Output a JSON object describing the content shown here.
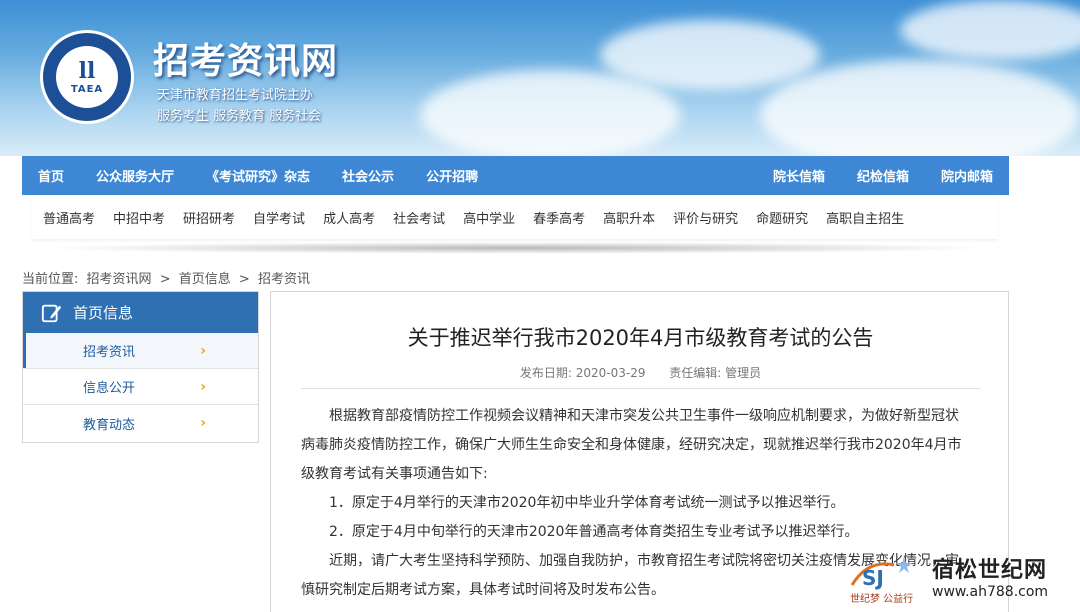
{
  "banner": {
    "logo_mark": "TAEA",
    "site_title": "招考资讯网",
    "subtitle_1": "天津市教育招生考试院主办",
    "subtitle_2": "服务考生 服务教育 服务社会"
  },
  "main_nav": {
    "left": [
      "首页",
      "公众服务大厅",
      "《考试研究》杂志",
      "社会公示",
      "公开招聘"
    ],
    "right": [
      "院长信箱",
      "纪检信箱",
      "院内邮箱"
    ]
  },
  "sub_nav": [
    "普通高考",
    "中招中考",
    "研招研考",
    "自学考试",
    "成人高考",
    "社会考试",
    "高中学业",
    "春季高考",
    "高职升本",
    "评价与研究",
    "命题研究",
    "高职自主招生"
  ],
  "breadcrumb": {
    "label": "当前位置:",
    "items": [
      "招考资讯网",
      "首页信息",
      "招考资讯"
    ],
    "sep": ">"
  },
  "sidebar": {
    "title": "首页信息",
    "items": [
      {
        "label": "招考资讯",
        "active": true
      },
      {
        "label": "信息公开",
        "active": false
      },
      {
        "label": "教育动态",
        "active": false
      }
    ],
    "chevron": "›"
  },
  "article": {
    "title": "关于推迟举行我市2020年4月市级教育考试的公告",
    "date_label": "发布日期:",
    "date": "2020-03-29",
    "editor_label": "责任编辑:",
    "editor": "管理员",
    "paragraphs": [
      "根据教育部疫情防控工作视频会议精神和天津市突发公共卫生事件一级响应机制要求，为做好新型冠状病毒肺炎疫情防控工作，确保广大师生生命安全和身体健康，经研究决定，现就推迟举行我市2020年4月市级教育考试有关事项通告如下:",
      "1．原定于4月举行的天津市2020年初中毕业升学体育考试统一测试予以推迟举行。",
      "2．原定于4月中旬举行的天津市2020年普通高考体育类招生专业考试予以推迟举行。",
      "近期，请广大考生坚持科学预防、加强自我防护，市教育招生考试院将密切关注疫情发展变化情况，审慎研究制定后期考试方案，具体考试时间将及时发布公告。"
    ]
  },
  "watermark": {
    "name": "宿松世纪网",
    "url": "www.ah788.com",
    "small": "世纪梦 公益行"
  },
  "colors": {
    "nav_blue": "#3d87d5",
    "sidebar_blue": "#2f70b3",
    "chevron_orange": "#f0a21c"
  }
}
